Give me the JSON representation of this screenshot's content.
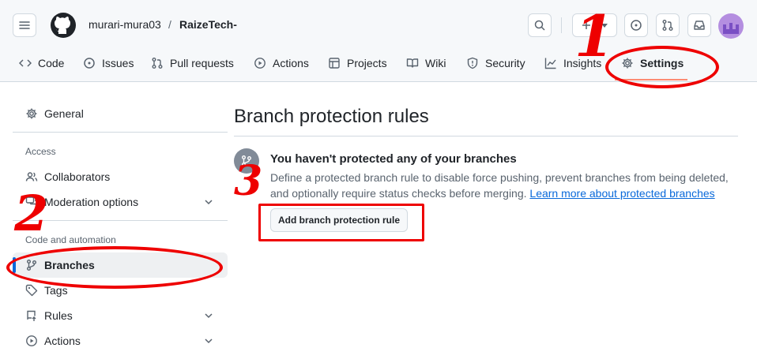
{
  "breadcrumb": {
    "owner": "murari-mura03",
    "separator": "/",
    "repo": "RaizeTech-"
  },
  "tabs": [
    {
      "label": "Code"
    },
    {
      "label": "Issues"
    },
    {
      "label": "Pull requests"
    },
    {
      "label": "Actions"
    },
    {
      "label": "Projects"
    },
    {
      "label": "Wiki"
    },
    {
      "label": "Security"
    },
    {
      "label": "Insights"
    },
    {
      "label": "Settings"
    }
  ],
  "sidebar": {
    "general": "General",
    "access_heading": "Access",
    "collaborators": "Collaborators",
    "moderation": "Moderation options",
    "code_heading": "Code and automation",
    "branches": "Branches",
    "tags": "Tags",
    "rules": "Rules",
    "actions": "Actions"
  },
  "main": {
    "title": "Branch protection rules",
    "blank_title": "You haven't protected any of your branches",
    "blank_line1": "Define a protected branch rule to disable force pushing, prevent branches from being deleted,",
    "blank_line2": "and optionally require status checks before merging.",
    "learn_more": "Learn more about protected branches",
    "add_button": "Add branch protection rule"
  },
  "annotations": {
    "n1": "1",
    "n2": "2",
    "n3": "3"
  },
  "colors": {
    "accent": "#fd8c73",
    "annotation": "#ee0000",
    "link": "#0969da"
  }
}
